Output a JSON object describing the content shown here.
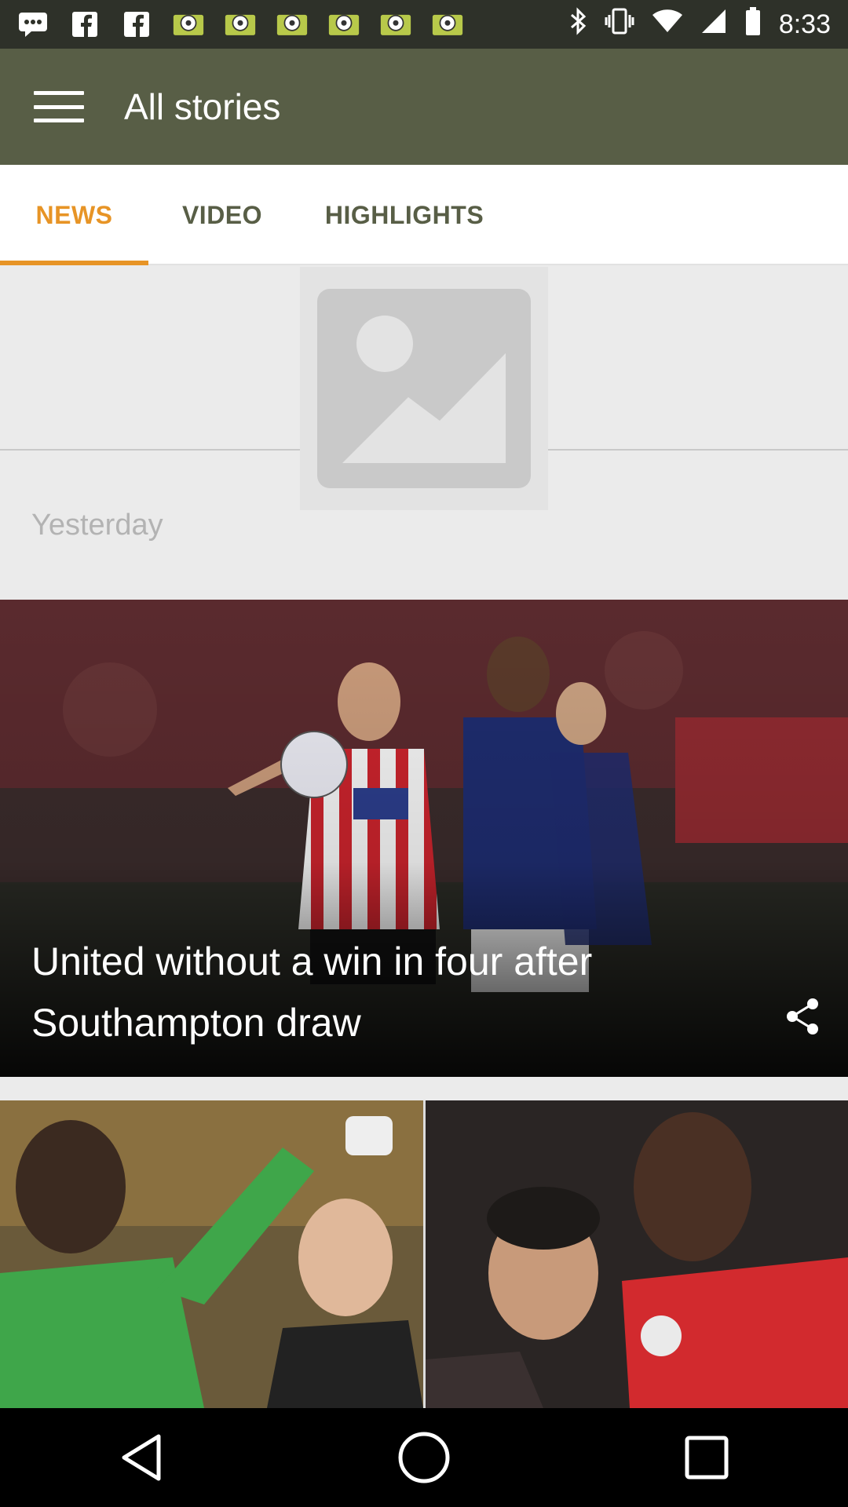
{
  "status_bar": {
    "time": "8:33",
    "notification_icons": [
      "chat-icon",
      "fb-icon",
      "fb-icon",
      "soccer-ball-icon",
      "soccer-ball-icon",
      "soccer-ball-icon",
      "soccer-ball-icon",
      "soccer-ball-icon",
      "soccer-ball-icon"
    ],
    "system_icons": [
      "bluetooth-icon",
      "vibrate-icon",
      "wifi-icon",
      "signal-icon",
      "battery-icon"
    ]
  },
  "app_bar": {
    "menu_icon": "hamburger-menu-icon",
    "title": "All stories",
    "background": "#585e46"
  },
  "tabs": [
    {
      "label": "NEWS",
      "active": true
    },
    {
      "label": "VIDEO",
      "active": false
    },
    {
      "label": "HIGHLIGHTS",
      "active": false
    }
  ],
  "accent_color": "#e79426",
  "section": {
    "placeholder_icon": "image-placeholder-icon",
    "date_label": "Yesterday"
  },
  "stories": [
    {
      "title": "United without a win in four after Southampton draw",
      "share_icon": "share-icon"
    }
  ],
  "thumbnails": [
    {
      "image": "goalkeeper-celebration-photo"
    },
    {
      "image": "united-players-photo"
    }
  ],
  "nav_bar": {
    "buttons": [
      "back-icon",
      "home-icon",
      "recents-icon"
    ]
  }
}
